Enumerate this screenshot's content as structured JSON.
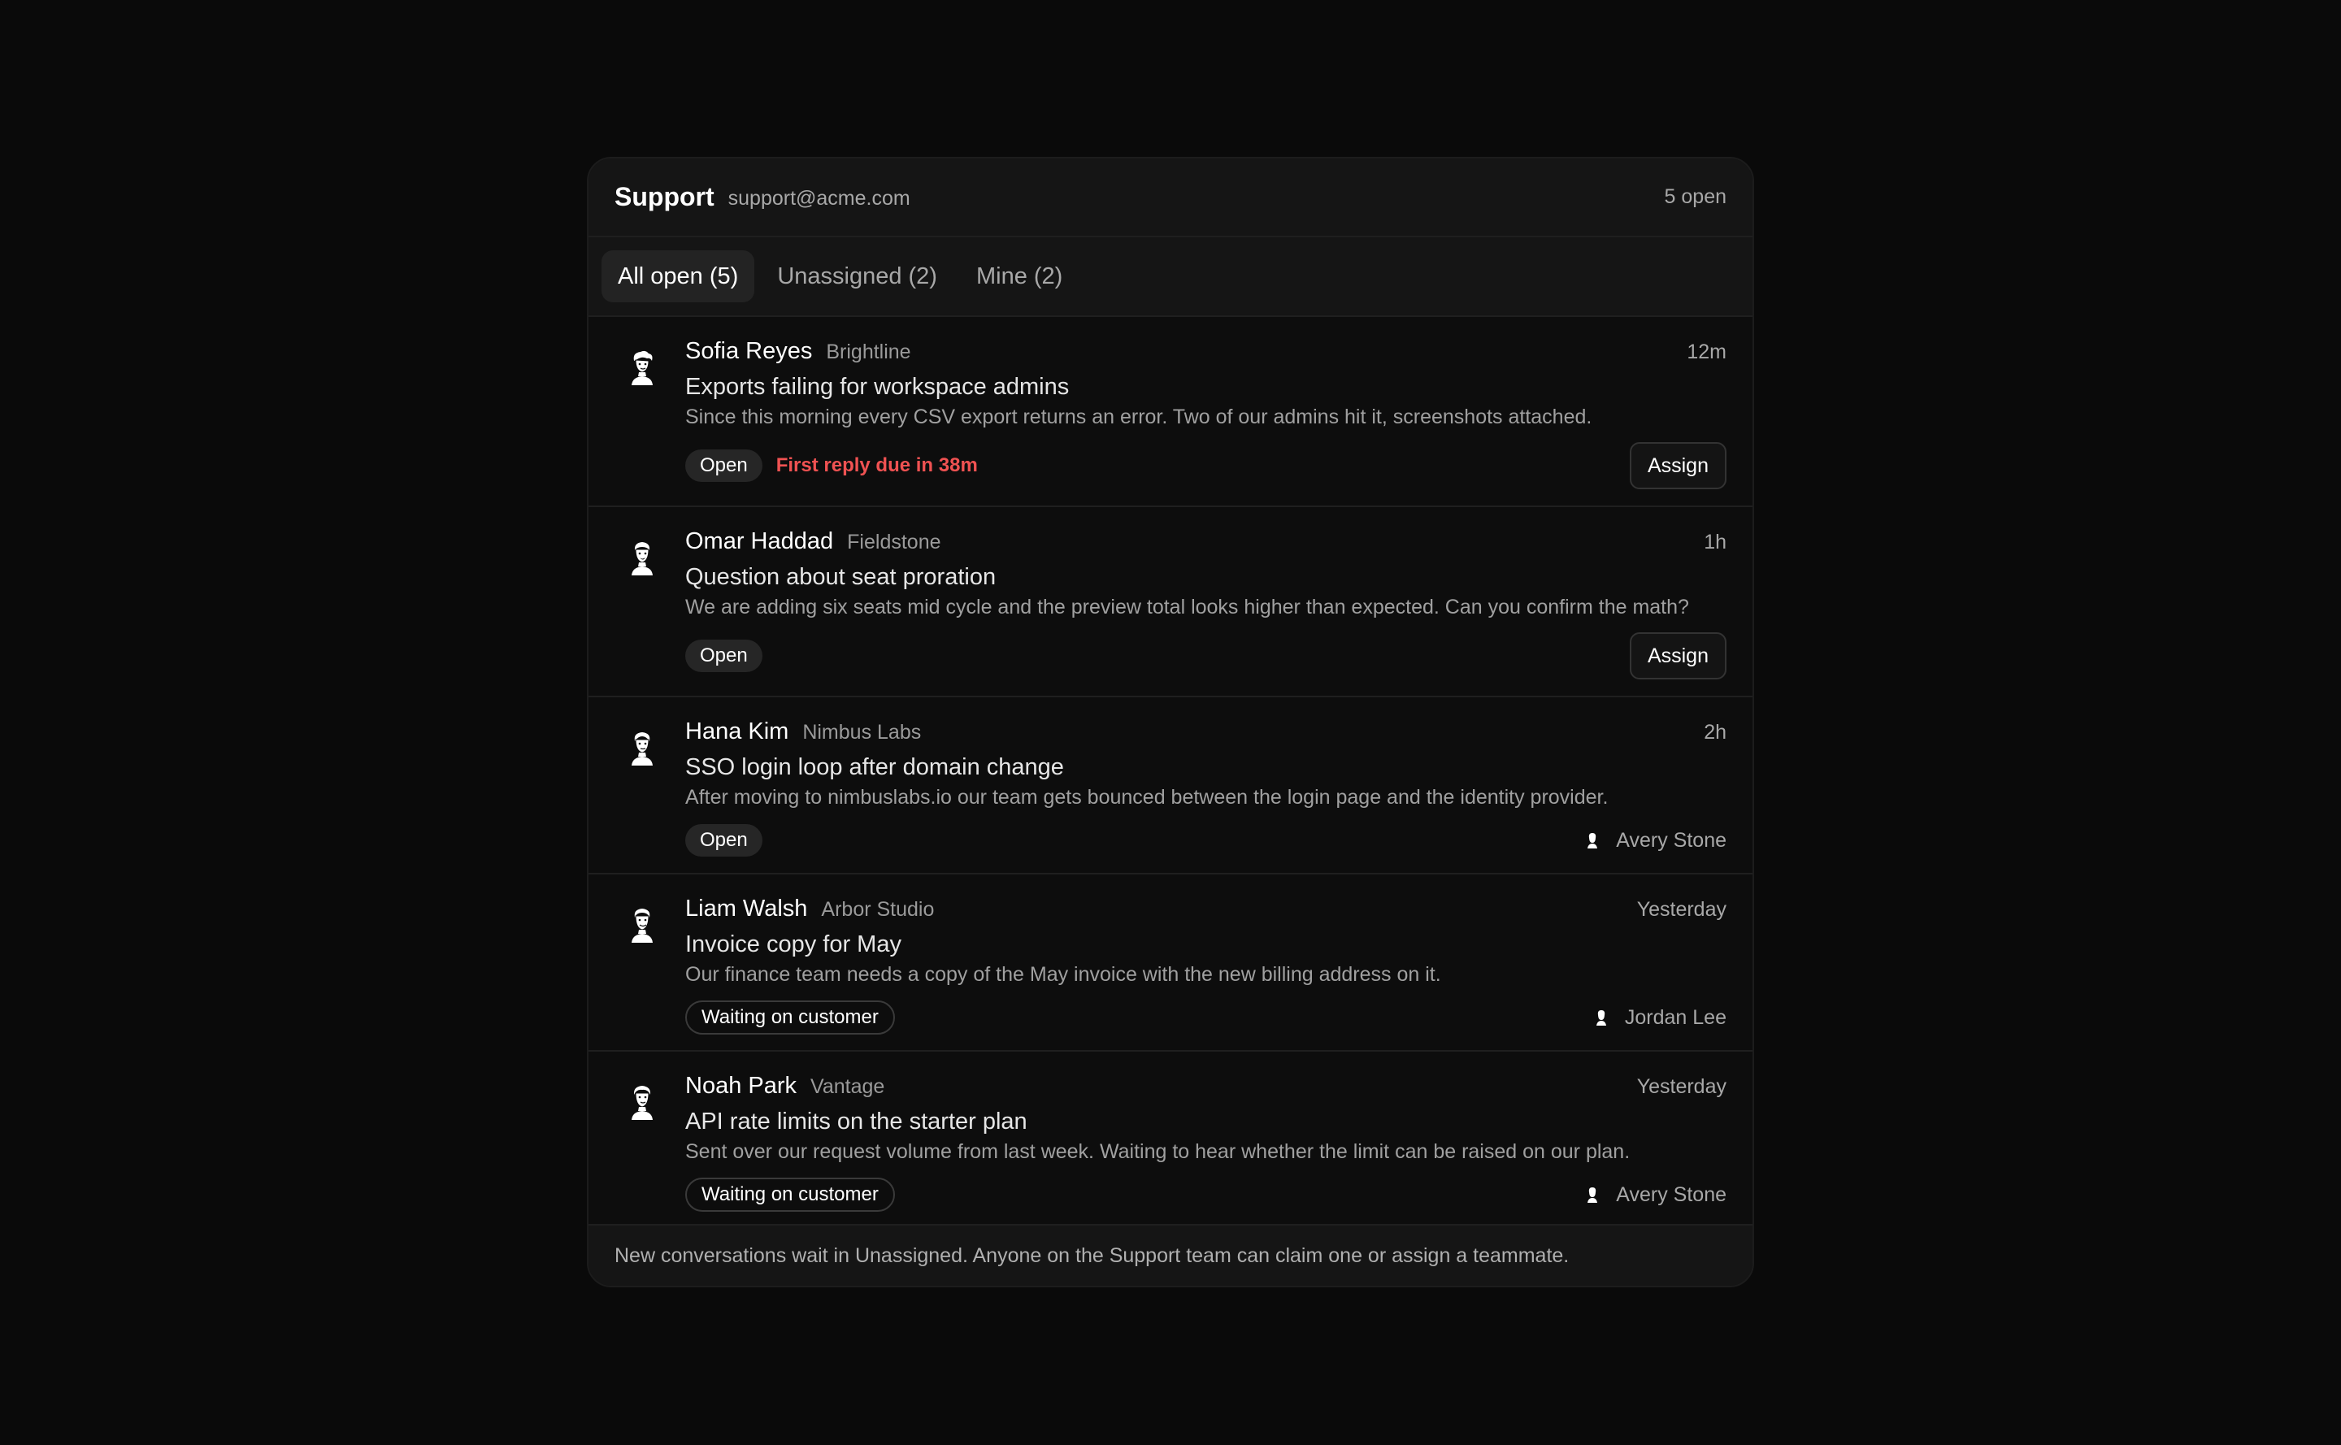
{
  "header": {
    "title": "Support",
    "email": "support@acme.com",
    "open_count": "5 open"
  },
  "tabs": [
    {
      "label": "All open (5)",
      "active": true
    },
    {
      "label": "Unassigned (2)",
      "active": false
    },
    {
      "label": "Mine (2)",
      "active": false
    }
  ],
  "conversations": [
    {
      "name": "Sofia Reyes",
      "company": "Brightline",
      "time": "12m",
      "subject": "Exports failing for workspace admins",
      "preview": "Since this morning every CSV export returns an error. Two of our admins hit it, screenshots attached.",
      "status": "Open",
      "due": "First reply due in 38m",
      "action": "Assign"
    },
    {
      "name": "Omar Haddad",
      "company": "Fieldstone",
      "time": "1h",
      "subject": "Question about seat proration",
      "preview": "We are adding six seats mid cycle and the preview total looks higher than expected. Can you confirm the math?",
      "status": "Open",
      "action": "Assign"
    },
    {
      "name": "Hana Kim",
      "company": "Nimbus Labs",
      "time": "2h",
      "subject": "SSO login loop after domain change",
      "preview": "After moving to nimbuslabs.io our team gets bounced between the login page and the identity provider.",
      "status": "Open",
      "assignee": "Avery Stone"
    },
    {
      "name": "Liam Walsh",
      "company": "Arbor Studio",
      "time": "Yesterday",
      "subject": "Invoice copy for May",
      "preview": "Our finance team needs a copy of the May invoice with the new billing address on it.",
      "status": "Waiting on customer",
      "assignee": "Jordan Lee"
    },
    {
      "name": "Noah Park",
      "company": "Vantage",
      "time": "Yesterday",
      "subject": "API rate limits on the starter plan",
      "preview": "Sent over our request volume from last week. Waiting to hear whether the limit can be raised on our plan.",
      "status": "Waiting on customer",
      "assignee": "Avery Stone"
    }
  ],
  "footer": {
    "text": "New conversations wait in Unassigned. Anyone on the Support team can claim one or assign a teammate."
  },
  "colors": {
    "background": "#0a0a0a",
    "panel": "#0d0d0d",
    "header": "#151515",
    "due_red": "#f05252"
  },
  "icons": {
    "avatar": "person-illustration-icon",
    "assignee": "mini-avatar-icon"
  }
}
